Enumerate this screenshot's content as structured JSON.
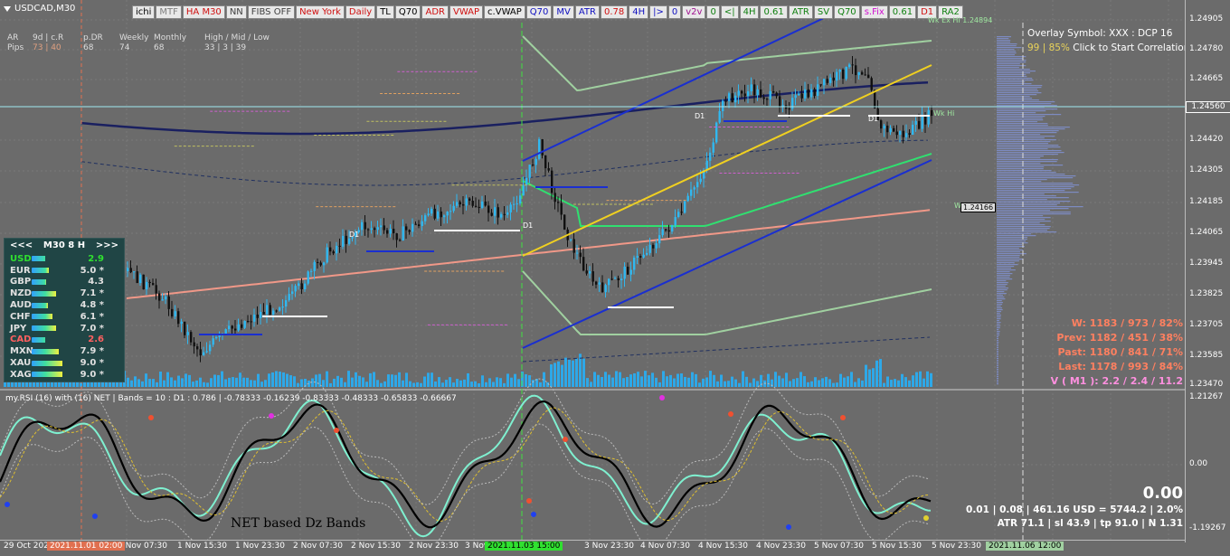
{
  "symbol": {
    "name": "USDCAD,M30"
  },
  "toolbar": {
    "buttons": [
      {
        "label": "ichi",
        "color": "#000000"
      },
      {
        "label": "MTF",
        "color": "#808080"
      },
      {
        "label": "HA M30",
        "color": "#d01010"
      },
      {
        "label": "NN",
        "color": "#404040"
      },
      {
        "label": "FIBS OFF",
        "color": "#404040"
      },
      {
        "label": "New York",
        "color": "#d01010"
      },
      {
        "label": "Daily",
        "color": "#d01010"
      },
      {
        "label": "TL",
        "color": "#000000"
      },
      {
        "label": "Q70",
        "color": "#000000"
      },
      {
        "label": "ADR",
        "color": "#d01010"
      },
      {
        "label": "VWAP",
        "color": "#d01010"
      },
      {
        "label": "c.VWAP",
        "color": "#000000"
      },
      {
        "label": "Q70",
        "color": "#1010c0"
      },
      {
        "label": "MV",
        "color": "#1010c0"
      },
      {
        "label": "ATR",
        "color": "#1010c0"
      },
      {
        "label": "0.78",
        "color": "#d01010"
      },
      {
        "label": "4H",
        "color": "#1010c0"
      },
      {
        "label": "|>",
        "color": "#1010c0"
      },
      {
        "label": "0",
        "color": "#1010c0"
      },
      {
        "label": "v2v",
        "color": "#a01090"
      },
      {
        "label": "0",
        "color": "#108010"
      },
      {
        "label": "<|",
        "color": "#108010"
      },
      {
        "label": "4H",
        "color": "#108010"
      },
      {
        "label": "0.61",
        "color": "#108010"
      },
      {
        "label": "ATR",
        "color": "#108010"
      },
      {
        "label": "SV",
        "color": "#108010"
      },
      {
        "label": "Q70",
        "color": "#108010"
      },
      {
        "label": "s.Fix",
        "color": "#d010d0"
      },
      {
        "label": "0.61",
        "color": "#108010"
      },
      {
        "label": "D1",
        "color": "#d01010"
      },
      {
        "label": "RA2",
        "color": "#108010"
      }
    ]
  },
  "stats": {
    "header": [
      "AR",
      "9d | c.R",
      "p.DR",
      "Weekly",
      "Monthly",
      "High / Mid / Low"
    ],
    "values": [
      "Pips",
      "73 | 40",
      "68",
      "74",
      "68",
      "33 | 3 | 39"
    ]
  },
  "strength": {
    "prev": "<<<",
    "title": "M30  8  H",
    "next": ">>>",
    "rows": [
      {
        "cur": "USD",
        "val": "2.9",
        "color": "#30e030",
        "fill": 0.29
      },
      {
        "cur": "EUR",
        "val": "5.0 *",
        "color": "#e0e0e0",
        "fill": 0.5
      },
      {
        "cur": "GBP",
        "val": "4.3",
        "color": "#e0e0e0",
        "fill": 0.43
      },
      {
        "cur": "NZD",
        "val": "7.1 *",
        "color": "#e0e0e0",
        "fill": 0.71
      },
      {
        "cur": "AUD",
        "val": "4.8 *",
        "color": "#e0e0e0",
        "fill": 0.48
      },
      {
        "cur": "CHF",
        "val": "6.1 *",
        "color": "#e0e0e0",
        "fill": 0.61
      },
      {
        "cur": "JPY",
        "val": "7.0 *",
        "color": "#e0e0e0",
        "fill": 0.7
      },
      {
        "cur": "CAD",
        "val": "2.6",
        "color": "#ff6060",
        "fill": 0.26
      },
      {
        "cur": "MXN",
        "val": "7.9 *",
        "color": "#e0e0e0",
        "fill": 0.79
      },
      {
        "cur": "XAU",
        "val": "9.0 *",
        "color": "#e0e0e0",
        "fill": 0.9
      },
      {
        "cur": "XAG",
        "val": "9.0 *",
        "color": "#e0e0e0",
        "fill": 0.9
      }
    ]
  },
  "overlay": {
    "line1": "Overlay Symbol: XXX : DCP 16",
    "line2_gold": "99 | 85%",
    "line2": " Click to Start Correlation"
  },
  "right_stats": [
    {
      "text": "W: 1183 / 973 / 82%",
      "color": "#ff8060"
    },
    {
      "text": "Prev: 1182 / 451 / 38%",
      "color": "#ff8060"
    },
    {
      "text": "Past: 1180 / 841 / 71%",
      "color": "#ff8060"
    },
    {
      "text": "Last: 1178 / 993 / 84%",
      "color": "#ff8060"
    },
    {
      "text": "V ( M1 ): 2.2 / 2.4 / 11.2",
      "color": "#ff90e0"
    }
  ],
  "atr": {
    "big": "0.00",
    "line1": "0.01  |  0.08  |  461.16 USD = 5744.2  |  2.0%",
    "line2": "ATR 71.1  |  sl 43.9  |  tp 91.0  |  N 1.31"
  },
  "price_axis": {
    "ticks": [
      "1.24905",
      "1.24780",
      "1.24665",
      "1.24420",
      "1.24305",
      "1.24185",
      "1.24065",
      "1.23945",
      "1.23825",
      "1.23705",
      "1.23585",
      "1.23470"
    ],
    "current": "1.24560",
    "marker": "1.24166",
    "rsi_ticks": [
      "1.21267",
      "0.00",
      "-1.19267"
    ]
  },
  "chart_labels": {
    "wk_ex_hi": "Wk Ex Hi 1.24894",
    "wk_hi": "Wk Hi",
    "wk_mid": "Wk M",
    "d1": "D1"
  },
  "rsi": {
    "title": "my.RSI (16) with (16) NET | Bands = 10 : D1 : 0.786 |  -0.78333 -0.16239 -0.83333 -0.48333 -0.65833 -0.66667",
    "net_label": "NET based Dz Bands"
  },
  "time_axis": {
    "ticks": [
      "29 Oct 2021",
      "1 Nov 07:30",
      "1 Nov 15:30",
      "1 Nov 23:30",
      "2 Nov 07:30",
      "2 Nov 15:30",
      "2 Nov 23:30",
      "3 Nov",
      "3 Nov 23:30",
      "4 Nov 07:30",
      "4 Nov 15:30",
      "4 Nov 23:30",
      "5 Nov 07:30",
      "5 Nov 15:30",
      "5 Nov 23:30"
    ],
    "tag_left": "2021.11.01 02:00",
    "tag_mid": "2021.11.03 15:00",
    "tag_right": "2021.11.06 12:00"
  }
}
